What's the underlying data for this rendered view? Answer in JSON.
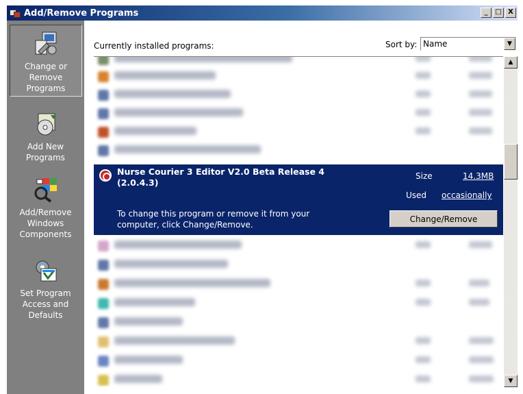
{
  "window": {
    "title": "Add/Remove Programs",
    "min": "_",
    "max": "□",
    "close": "X"
  },
  "sidebar": {
    "items": [
      {
        "label": "Change or Remove Programs",
        "icon": "change-remove-icon",
        "active": true
      },
      {
        "label": "Add New Programs",
        "icon": "cd-install-icon",
        "active": false
      },
      {
        "label": "Add/Remove Windows Components",
        "icon": "windows-components-icon",
        "active": false
      },
      {
        "label": "Set Program Access and Defaults",
        "icon": "program-defaults-icon",
        "active": false
      }
    ]
  },
  "main": {
    "header_label": "Currently installed programs:",
    "sort_label": "Sort by:",
    "sort_value": "Name"
  },
  "selected_program": {
    "name": "Nurse Courier 3 Editor V2.0 Beta Release 4 (2.0.4.3)",
    "size_label": "Size",
    "size_value": "14.3MB",
    "used_label": "Used",
    "used_value": "occasionally",
    "description": "To change this program or remove it from your computer, click Change/Remove.",
    "button_label": "Change/Remove"
  },
  "colors": {
    "selection": "#0a246a",
    "sidebar": "#808080",
    "face": "#d4d0c8"
  }
}
